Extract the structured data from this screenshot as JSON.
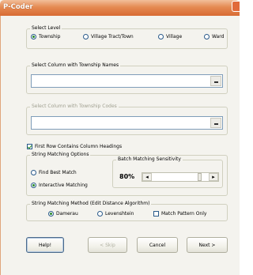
{
  "window": {
    "title": "P-Coder"
  },
  "select_level": {
    "legend": "Select Level",
    "options": [
      {
        "label": "Township",
        "selected": true
      },
      {
        "label": "Village Tract/Town",
        "selected": false
      },
      {
        "label": "Village",
        "selected": false
      },
      {
        "label": "Ward",
        "selected": false
      }
    ]
  },
  "township_names": {
    "legend": "Select Column with Township Names",
    "value": ""
  },
  "township_codes": {
    "legend": "Select Column with Township Codes",
    "value": "",
    "disabled": true
  },
  "first_row": {
    "label": "First Row Contains Column Headings",
    "checked": true
  },
  "string_matching": {
    "legend": "String Matching Options",
    "options": [
      {
        "label": "Find Best Match",
        "selected": false
      },
      {
        "label": "Interactive Matching",
        "selected": true
      }
    ],
    "sensitivity": {
      "legend": "Batch Matching Sensitivity",
      "value_label": "80%",
      "value": 0.8
    }
  },
  "method": {
    "legend": "String Matching Method (Edit Distance Algorithm)",
    "options": [
      {
        "label": "Damerau",
        "selected": true
      },
      {
        "label": "Levenshtein",
        "selected": false
      }
    ],
    "match_pattern": {
      "label": "Match Pattern Only",
      "checked": false
    }
  },
  "buttons": {
    "help": "Help!",
    "skip": "< Skip",
    "cancel": "Cancel",
    "next": "Next >"
  }
}
